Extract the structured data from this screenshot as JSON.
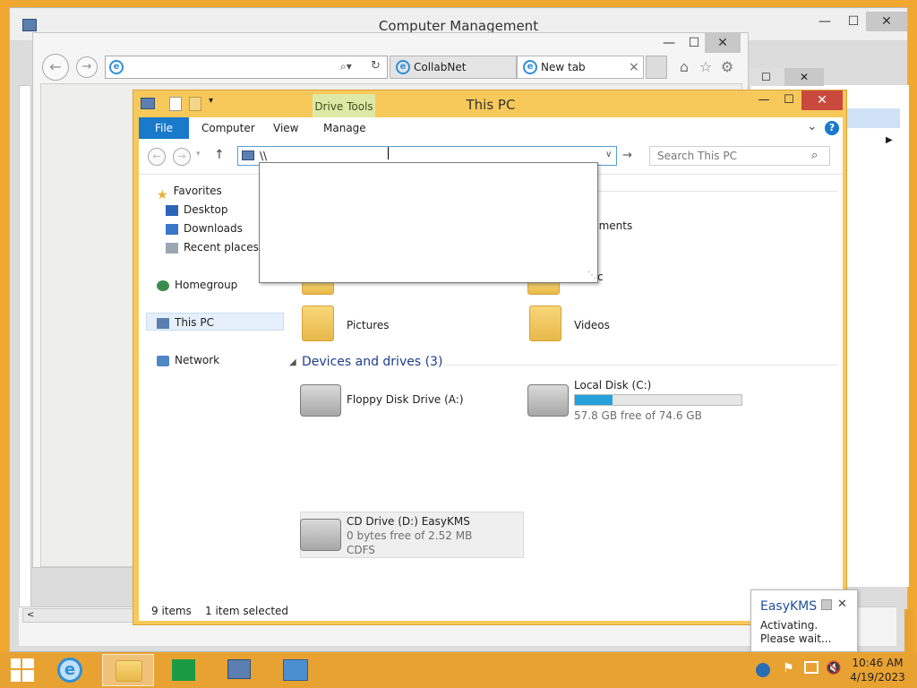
{
  "computer_management": {
    "title": "Computer Management",
    "min": "—",
    "max": "☐",
    "close": "✕",
    "scroll_left": "<"
  },
  "ie": {
    "tabs": [
      {
        "label": "CollabNet"
      },
      {
        "label": "New tab",
        "close": "×"
      }
    ],
    "back": "←",
    "forward": "→",
    "search_glyph": "⌕▾",
    "refresh": "↻",
    "home": "⌂",
    "favorites": "☆",
    "settings": "⚙",
    "min": "—",
    "max": "☐",
    "close": "✕"
  },
  "explorer": {
    "title": "This PC",
    "contextual_tab": "Drive Tools",
    "min": "—",
    "max": "☐",
    "close": "✕",
    "ribbon_tabs": [
      "File",
      "Computer",
      "View",
      "Manage"
    ],
    "help": "?",
    "ribbon_expand": "⌄",
    "address_value": "\\\\",
    "search_placeholder": "Search This PC",
    "nav": {
      "favorites": "Favorites",
      "desktop": "Desktop",
      "downloads": "Downloads",
      "recent": "Recent places",
      "homegroup": "Homegroup",
      "this_pc": "This PC",
      "network": "Network"
    },
    "folders": {
      "partial_documents": "uments",
      "partial_music": "c",
      "pictures": "Pictures",
      "videos": "Videos"
    },
    "devices_section": "Devices and drives (3)",
    "drives": {
      "floppy": "Floppy Disk Drive (A:)",
      "local_c": "Local Disk (C:)",
      "local_c_free": "57.8 GB free of 74.6 GB",
      "local_c_used_fraction": 0.225,
      "cd_name": "CD Drive (D:) EasyKMS",
      "cd_free": "0 bytes free of 2.52 MB",
      "cd_fs": "CDFS"
    },
    "status_items": "9 items",
    "status_selected": "1 item selected"
  },
  "balloon": {
    "title": "EasyKMS",
    "message_line1": "Activating.",
    "message_line2": "Please wait...",
    "close": "✕"
  },
  "taskbar": {
    "time": "10:46 AM",
    "date": "4/19/2023"
  }
}
